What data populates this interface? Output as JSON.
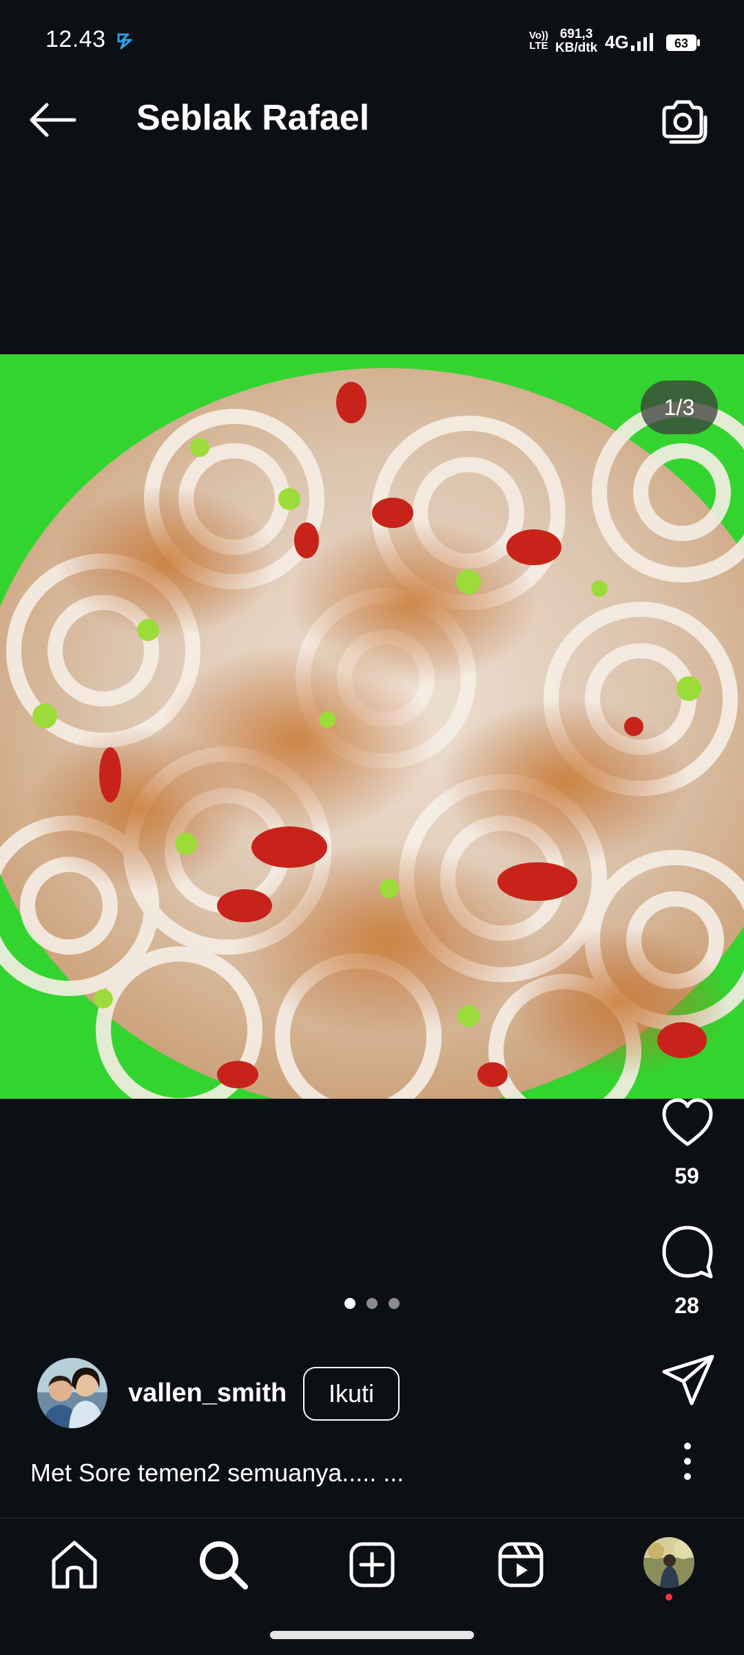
{
  "status_bar": {
    "time": "12.43",
    "volte_top": "Vo))",
    "volte_bottom": "LTE",
    "speed_top": "691,3",
    "speed_bottom": "KB/dtk",
    "network": "4G",
    "battery": "63"
  },
  "header": {
    "title": "Seblak Rafael",
    "back_icon": "arrow-left-icon",
    "camera_icon": "camera-icon"
  },
  "post": {
    "image_alt": "Seblak noodle dish with chili sauce",
    "image_counter": "1/3",
    "carousel": {
      "current": 1,
      "total": 3
    },
    "likes": "59",
    "comments": "28",
    "author": "vallen_smith",
    "follow_label": "Ikuti",
    "caption": "Met Sore temen2 semuanya..... ..."
  },
  "nav": {
    "items": [
      "home-icon",
      "search-icon",
      "add-post-icon",
      "reels-icon",
      "profile-avatar"
    ]
  },
  "colors": {
    "background": "#0c0f14",
    "plate_green": "#2fd234",
    "notification_dot": "#ff3040"
  }
}
